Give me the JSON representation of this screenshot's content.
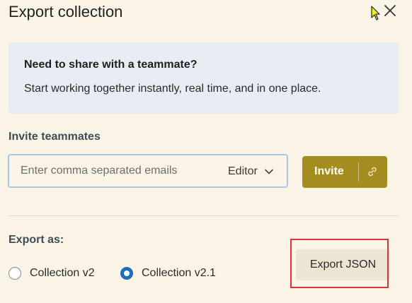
{
  "header": {
    "title": "Export collection",
    "close_icon": "close-icon",
    "cursor_icon": "mouse-pointer-icon"
  },
  "banner": {
    "heading": "Need to share with a teammate?",
    "text": "Start working together instantly, real time, and in one place."
  },
  "invite": {
    "label": "Invite teammates",
    "email_placeholder": "Enter comma separated emails",
    "email_value": "",
    "role": "Editor",
    "button_label": "Invite",
    "link_icon": "link-icon"
  },
  "export": {
    "label": "Export as:",
    "options": [
      {
        "label": "Collection v2",
        "selected": false
      },
      {
        "label": "Collection v2.1",
        "selected": true
      }
    ],
    "button_label": "Export JSON"
  },
  "colors": {
    "background": "#faf4e6",
    "banner": "#e7edf3",
    "invite_button": "#a58c1e",
    "radio_selected": "#1f6fb8",
    "highlight": "#e0303a"
  }
}
